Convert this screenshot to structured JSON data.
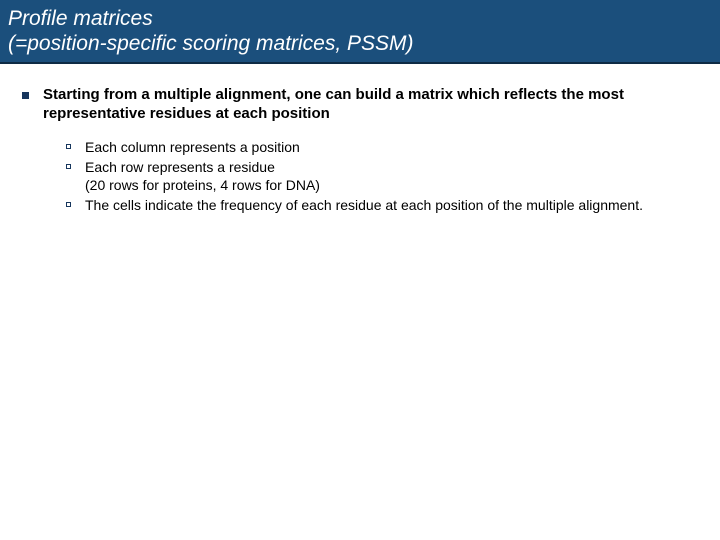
{
  "header": {
    "line1": "Profile matrices",
    "line2": "(=position-specific scoring matrices, PSSM)"
  },
  "main": {
    "point": "Starting from a multiple alignment, one can build a matrix which reflects the most representative residues at each position",
    "subs": [
      "Each column represents a position",
      "Each row represents a residue\n(20 rows for proteins, 4 rows for DNA)",
      "The cells indicate the frequency of each residue at each position of the multiple alignment."
    ]
  }
}
